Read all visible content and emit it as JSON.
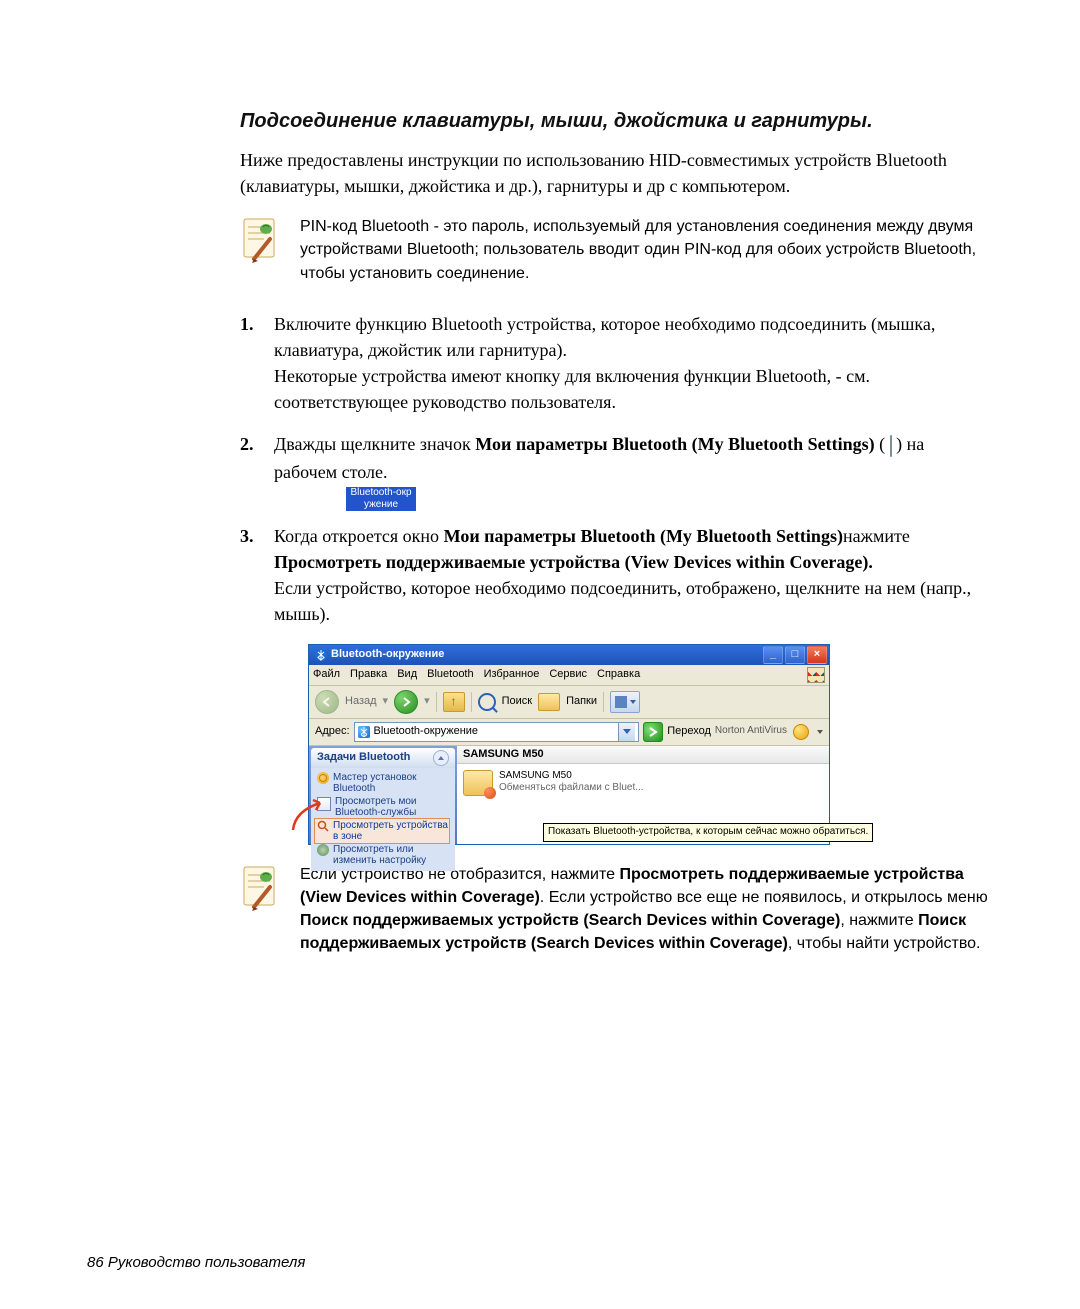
{
  "heading": "Подсоединение клавиатуры, мыши, джойстика и гарнитуры.",
  "intro": "Ниже предоставлены инструкции по использованию HID-совместимых устройств Bluetooth (клавиатуры, мышки, джойстика и др.), гарнитуры и др с компьютером.",
  "note1": "PIN-код Bluetooth - это пароль, используемый для установления соединения между двумя устройствами Bluetooth; пользователь вводит один PIN-код для обоих устройств Bluetooth, чтобы установить соединение.",
  "steps": {
    "s1a": "Включите функцию Bluetooth устройства, которое необходимо подсоединить (мышка, клавиатура, джойстик или гарнитура).",
    "s1b": "Некоторые устройства имеют кнопку для включения функции Bluetooth, - см. соответствующее руководство пользователя.",
    "s2_pre": "Дважды щелкните значок ",
    "s2_bold": "Мои параметры  Bluetooth (My Bluetooth Settings)",
    "s2_mid": " (",
    "s2_post": ") на рабочем столе.",
    "s2_caption1": "Bluetooth-окр",
    "s2_caption2": "ужение",
    "s3_pre": "Когда откроется окно ",
    "s3_bold1": "Мои параметры Bluetooth (My Bluetooth Settings)",
    "s3_mid": "нажмите ",
    "s3_bold2": "Просмотреть поддерживаемые устройства (View Devices within Coverage).",
    "s3_after": "Если устройство, которое необходимо подсоединить, отображено, щелкните на нем (напр., мышь)."
  },
  "win": {
    "title": "Bluetooth-окружение",
    "menu": {
      "file": "Файл",
      "edit": "Правка",
      "view": "Вид",
      "bt": "Bluetooth",
      "fav": "Избранное",
      "tools": "Сервис",
      "help": "Справка"
    },
    "back": "Назад",
    "search": "Поиск",
    "folders": "Папки",
    "addr_label": "Адрес:",
    "addr_value": "Bluetooth-окружение",
    "go": "Переход",
    "norton": "Norton AntiVirus",
    "task_header": "Задачи Bluetooth",
    "task1": "Мастер установок Bluetooth",
    "task2": "Просмотреть мои Bluetooth-службы",
    "task3": "Просмотреть устройства в зоне",
    "task4": "Просмотреть или изменить настройку",
    "col": "SAMSUNG M50",
    "dev_name": "SAMSUNG M50",
    "dev_desc": "Обменяться файлами с Bluet...",
    "tooltip": "Показать Bluetooth-устройства, к которым сейчас можно обратиться."
  },
  "note2": {
    "t1": "Если устройство не отобразится, нажмите ",
    "b1": "Просмотреть поддерживаемые устройства (View Devices within Coverage)",
    "t2": ". Если устройство все еще не появилось, и открылось меню ",
    "b2": "Поиск поддерживаемых устройств (Search Devices within Coverage)",
    "t3": ", нажмите ",
    "b3": "Поиск поддерживаемых устройств (Search Devices within Coverage)",
    "t4": ", чтобы найти устройство."
  },
  "footer": "86  Руководство пользователя"
}
